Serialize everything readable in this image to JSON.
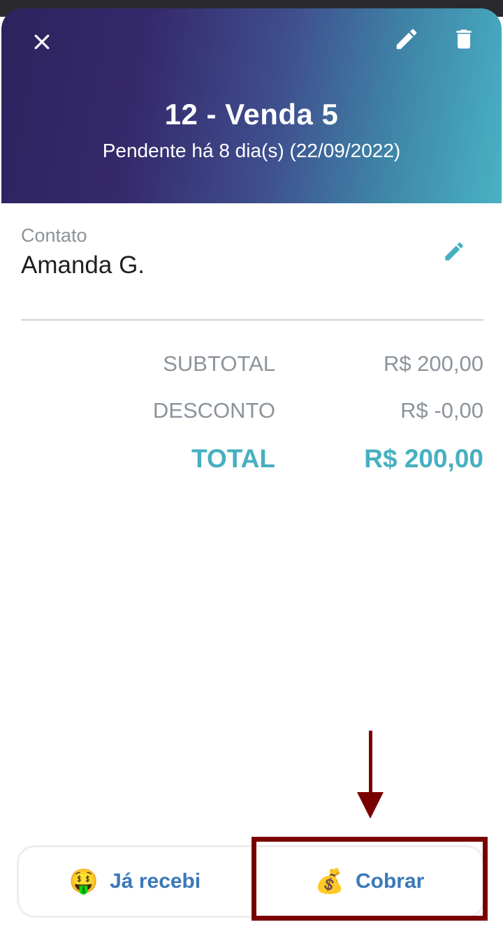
{
  "header": {
    "title": "12 - Venda 5",
    "subtitle": "Pendente há 8 dia(s) (22/09/2022)",
    "icons": {
      "close": "close-icon",
      "edit": "pencil-icon",
      "delete": "trash-icon"
    }
  },
  "contact": {
    "label": "Contato",
    "name": "Amanda G.",
    "edit_icon": "pencil-icon"
  },
  "summary": {
    "subtotal_label": "SUBTOTAL",
    "subtotal_value": "R$ 200,00",
    "discount_label": "DESCONTO",
    "discount_value": "R$ -0,00",
    "total_label": "TOTAL",
    "total_value": "R$ 200,00"
  },
  "actions": {
    "received_label": "Já recebi",
    "received_emoji": "🤑",
    "charge_label": "Cobrar",
    "charge_emoji": "💰"
  },
  "colors": {
    "accent": "#46b0c0",
    "button_text": "#3b78b8",
    "annotation": "#7a0000",
    "header_gradient_start": "#2c235f",
    "header_gradient_end": "#49b2c4"
  }
}
